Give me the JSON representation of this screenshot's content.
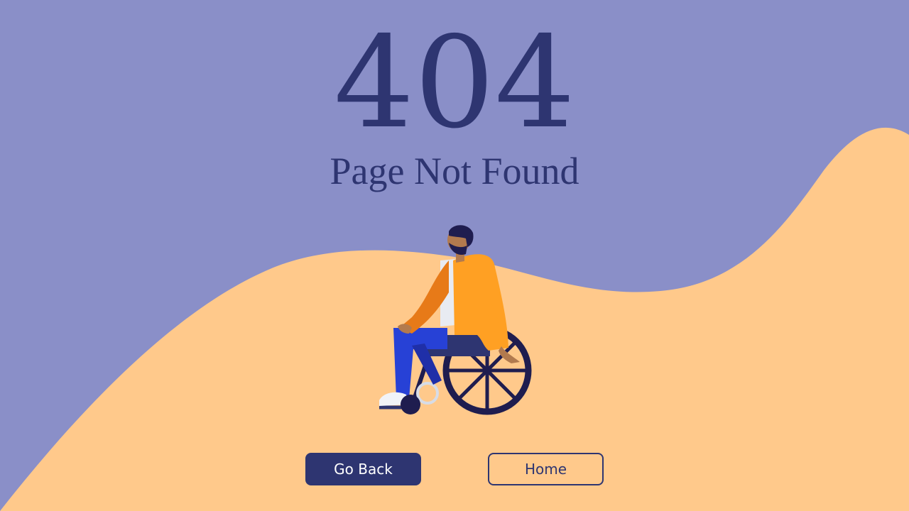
{
  "page": {
    "error_code": "404",
    "message": "Page Not Found"
  },
  "actions": {
    "back_label": "Go Back",
    "home_label": "Home"
  },
  "illustration": {
    "subject": "person-in-wheelchair"
  },
  "colors": {
    "sky": "#8a8fc8",
    "hill": "#ffc98b",
    "ink": "#2e3571",
    "jacket": "#ffa023",
    "jacket_shadow": "#e77a18",
    "pants": "#2741d6",
    "skin": "#b27a4e",
    "wheel": "#1f1d4f"
  }
}
